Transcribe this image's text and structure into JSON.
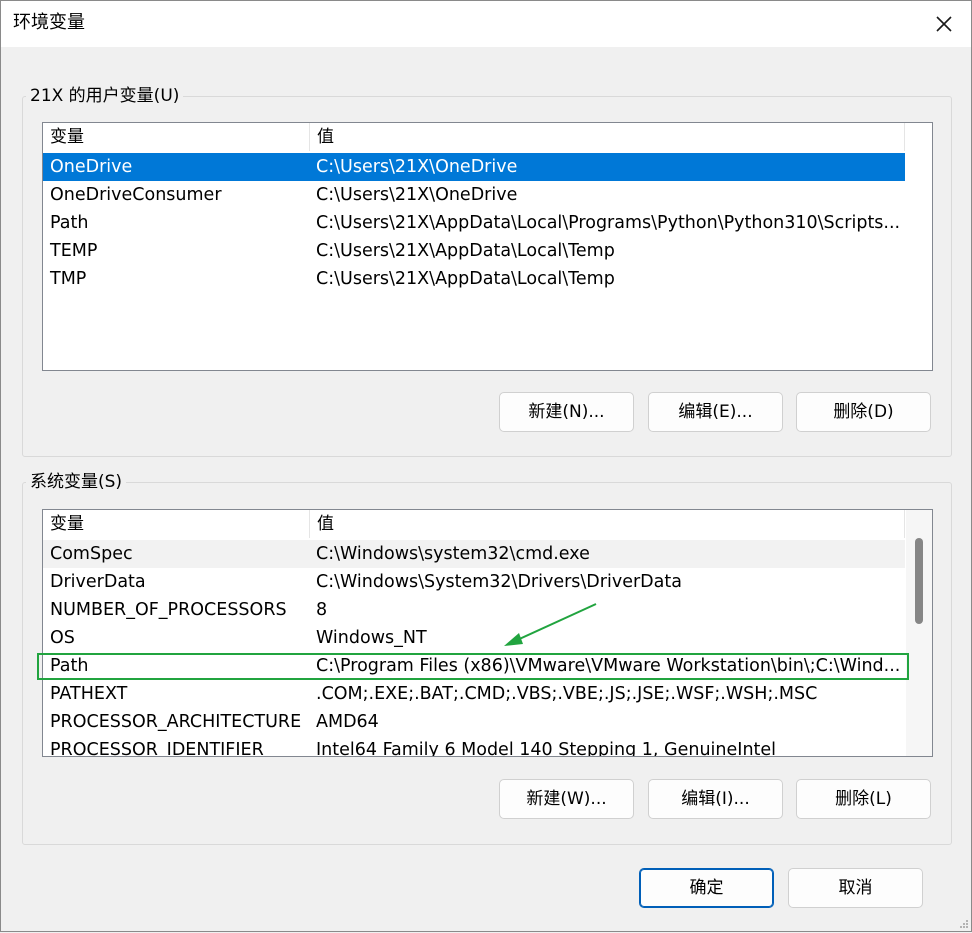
{
  "window": {
    "title": "环境变量",
    "close_glyph": "✕"
  },
  "user_vars": {
    "group_label": "21X 的用户变量(U)",
    "columns": [
      "变量",
      "值"
    ],
    "rows": [
      {
        "name": "OneDrive",
        "value": "C:\\Users\\21X\\OneDrive",
        "selected": true
      },
      {
        "name": "OneDriveConsumer",
        "value": "C:\\Users\\21X\\OneDrive"
      },
      {
        "name": "Path",
        "value": "C:\\Users\\21X\\AppData\\Local\\Programs\\Python\\Python310\\Scripts..."
      },
      {
        "name": "TEMP",
        "value": "C:\\Users\\21X\\AppData\\Local\\Temp"
      },
      {
        "name": "TMP",
        "value": "C:\\Users\\21X\\AppData\\Local\\Temp"
      }
    ],
    "buttons": {
      "new": "新建(N)...",
      "edit": "编辑(E)...",
      "delete": "删除(D)"
    }
  },
  "system_vars": {
    "group_label": "系统变量(S)",
    "columns": [
      "变量",
      "值"
    ],
    "rows": [
      {
        "name": "ComSpec",
        "value": "C:\\Windows\\system32\\cmd.exe"
      },
      {
        "name": "DriverData",
        "value": "C:\\Windows\\System32\\Drivers\\DriverData"
      },
      {
        "name": "NUMBER_OF_PROCESSORS",
        "value": "8"
      },
      {
        "name": "OS",
        "value": "Windows_NT"
      },
      {
        "name": "Path",
        "value": "C:\\Program Files (x86)\\VMware\\VMware Workstation\\bin\\;C:\\Wind...",
        "highlighted": true
      },
      {
        "name": "PATHEXT",
        "value": ".COM;.EXE;.BAT;.CMD;.VBS;.VBE;.JS;.JSE;.WSF;.WSH;.MSC"
      },
      {
        "name": "PROCESSOR_ARCHITECTURE",
        "value": "AMD64"
      },
      {
        "name": "PROCESSOR_IDENTIFIER",
        "value": "Intel64 Family 6 Model 140 Stepping 1, GenuineIntel"
      }
    ],
    "buttons": {
      "new": "新建(W)...",
      "edit": "编辑(I)...",
      "delete": "删除(L)"
    }
  },
  "footer": {
    "ok": "确定",
    "cancel": "取消"
  },
  "colors": {
    "selection": "#0078d7",
    "annotation": "#21a43f",
    "primary_border": "#005fb8"
  }
}
